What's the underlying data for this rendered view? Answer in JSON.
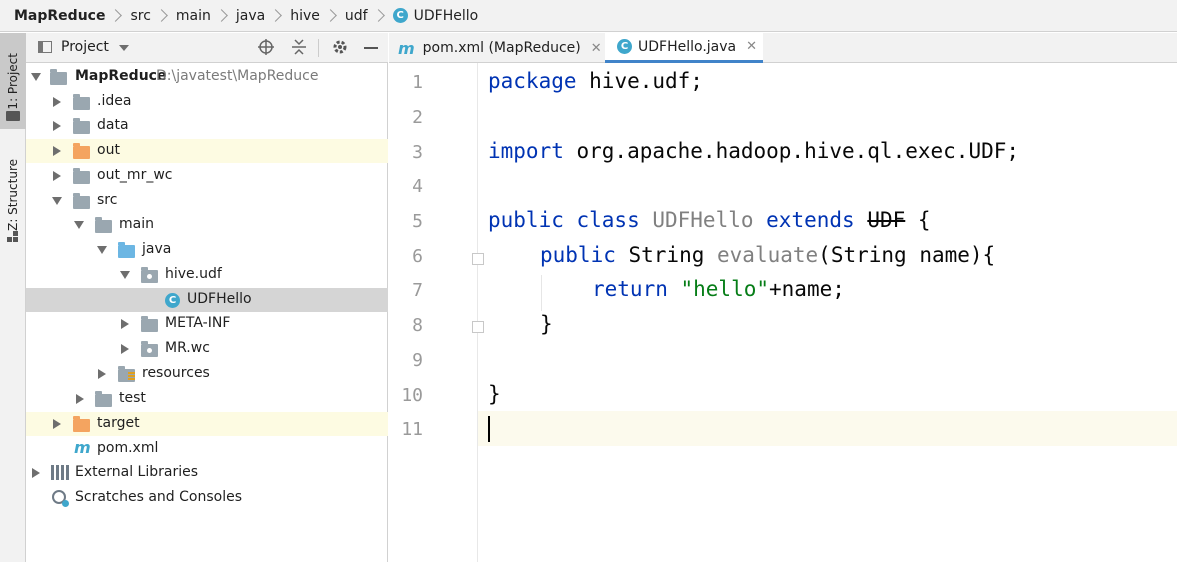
{
  "breadcrumb": {
    "items": [
      "MapReduce",
      "src",
      "main",
      "java",
      "hive",
      "udf",
      "UDFHello"
    ],
    "class_icon_letter": "C"
  },
  "tool_stripe": {
    "project_tab": "1: Project",
    "structure_tab": "Z: Structure"
  },
  "project_panel": {
    "title": "Project",
    "tree": [
      {
        "label": "MapReduce",
        "path": "D:\\javatest\\MapReduce"
      },
      {
        "label": ".idea"
      },
      {
        "label": "data"
      },
      {
        "label": "out"
      },
      {
        "label": "out_mr_wc"
      },
      {
        "label": "src"
      },
      {
        "label": "main"
      },
      {
        "label": "java"
      },
      {
        "label": "hive.udf"
      },
      {
        "label": "UDFHello"
      },
      {
        "label": "META-INF"
      },
      {
        "label": "MR.wc"
      },
      {
        "label": "resources"
      },
      {
        "label": "test"
      },
      {
        "label": "target"
      },
      {
        "label": "pom.xml"
      },
      {
        "label": "External Libraries"
      },
      {
        "label": "Scratches and Consoles"
      }
    ]
  },
  "editor": {
    "tabs": [
      {
        "label": "pom.xml (MapReduce)",
        "icon": "m"
      },
      {
        "label": "UDFHello.java",
        "icon": "C"
      }
    ],
    "line_numbers": [
      "1",
      "2",
      "3",
      "4",
      "5",
      "6",
      "7",
      "8",
      "9",
      "10",
      "11"
    ],
    "code": {
      "l1_kw": "package",
      "l1_rest": " hive.udf;",
      "l3_kw": "import",
      "l3_rest": " org.apache.hadoop.hive.ql.exec.UDF;",
      "l5_kw1": "public class",
      "l5_cls": " UDFHello",
      "l5_kw2": " extends",
      "l5_sup": "UDF",
      "l5_brace": " {",
      "l6_kw": "public",
      "l6_type": " String",
      "l6_fn": " evaluate",
      "l6_rest": "(String name){",
      "l7_kw": "return",
      "l7_str": " \"hello\"",
      "l7_rest": "+name;",
      "l8": "}",
      "l10": "}"
    }
  },
  "colors": {
    "keyword": "#0033b3",
    "string": "#067d17",
    "selection": "#d5d5d5",
    "highlight": "#fdfbe2",
    "active_tab_underline": "#4083c9"
  }
}
